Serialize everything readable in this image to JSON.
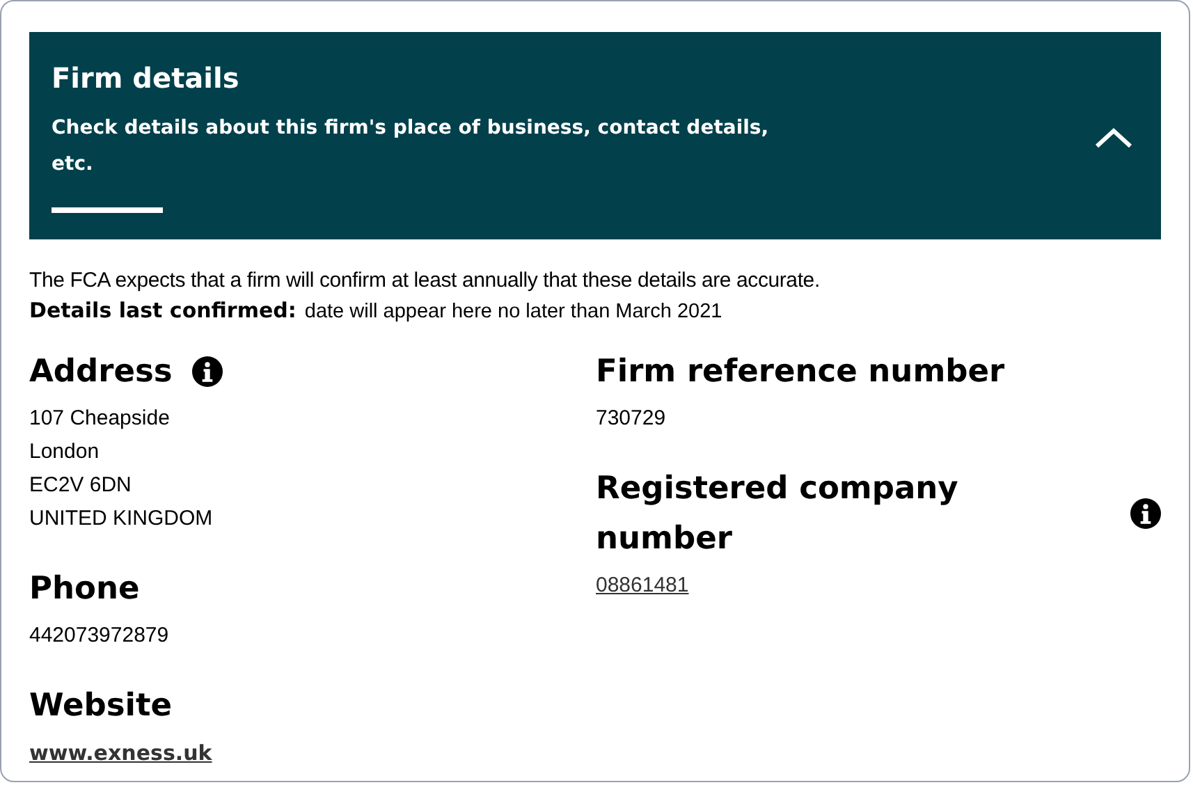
{
  "panel": {
    "title": "Firm details",
    "description": "Check details about this firm's place of business, contact details, etc.",
    "expanded": true
  },
  "notice": "The FCA expects that a firm will confirm at least annually that these details are accurate.",
  "confirmed": {
    "label": "Details last confirmed:",
    "value": "date will appear here no later than March 2021"
  },
  "columns": [
    [
      {
        "heading": "Address",
        "info": true,
        "kind": "text",
        "lines": [
          "107 Cheapside",
          "London",
          "EC2V 6DN",
          "UNITED KINGDOM"
        ]
      },
      {
        "heading": "Phone",
        "info": false,
        "kind": "text",
        "lines": [
          "442073972879"
        ]
      },
      {
        "heading": "Website",
        "info": false,
        "kind": "weblink",
        "lines": [
          "www.exness.uk"
        ]
      }
    ],
    [
      {
        "heading": "Firm reference number",
        "info": false,
        "kind": "text",
        "lines": [
          "730729"
        ]
      },
      {
        "heading": "Registered company number",
        "info": true,
        "kind": "link",
        "lines": [
          "08861481"
        ]
      }
    ]
  ]
}
